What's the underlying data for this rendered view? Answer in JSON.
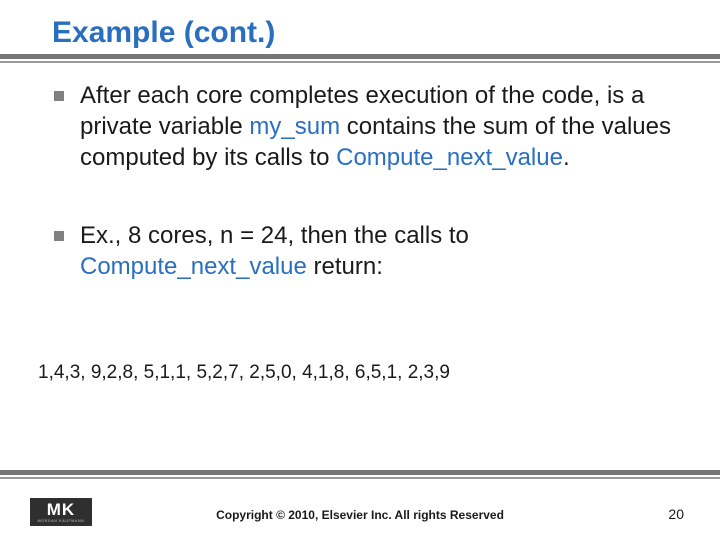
{
  "title": "Example (cont.)",
  "bullets": [
    {
      "pre": "After each core completes execution of the code, is a private variable ",
      "kw1": "my_sum",
      "mid": " contains the sum of the values computed by its calls to ",
      "kw2": "Compute_next_value",
      "post": "."
    },
    {
      "pre": "Ex., 8 cores, n = 24, then the calls to ",
      "kw1": "Compute_next_value",
      "mid": "",
      "kw2": "",
      "post": " return:"
    }
  ],
  "data_groups": "1,4,3,   9,2,8,    5,1,1,   5,2,7,   2,5,0,   4,1,8,   6,5,1,   2,3,9",
  "logo": {
    "main": "MK",
    "sub": "MORGAN KAUFMANN"
  },
  "copyright": "Copyright © 2010, Elsevier Inc. All rights Reserved",
  "page": "20"
}
